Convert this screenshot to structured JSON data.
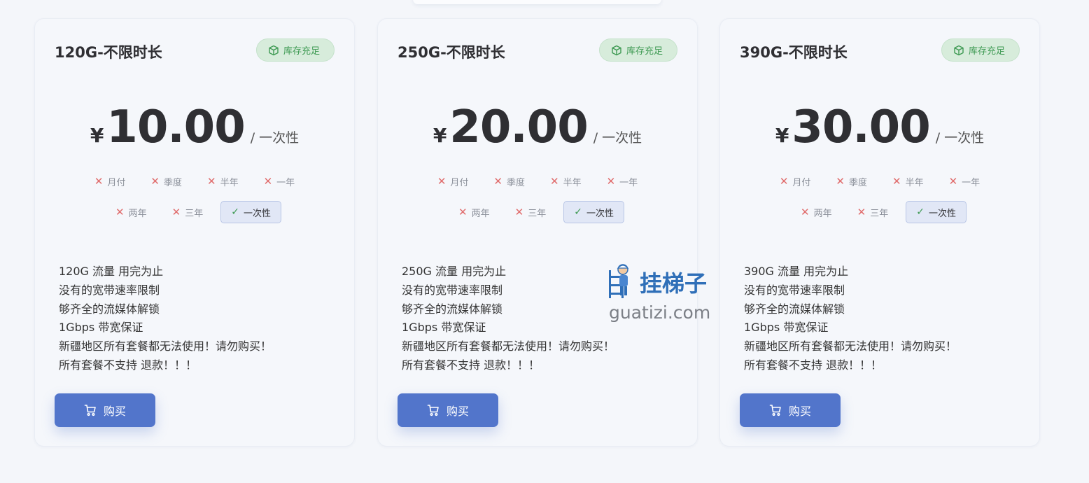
{
  "plans": [
    {
      "title": "120G-不限时长",
      "stock_label": "库存充足",
      "currency": "¥",
      "price": "10.00",
      "period": "/ 一次性",
      "cycles_row1": [
        "月付",
        "季度",
        "半年",
        "一年"
      ],
      "cycles_row2": [
        "两年",
        "三年"
      ],
      "selected_cycle": "一次性",
      "features": [
        "120G 流量 用完为止",
        "没有的宽带速率限制",
        "够齐全的流媒体解锁",
        "1Gbps 带宽保证",
        "新疆地区所有套餐都无法使用！请勿购买！",
        "所有套餐不支持 退款！！！"
      ],
      "buy_label": "购买"
    },
    {
      "title": "250G-不限时长",
      "stock_label": "库存充足",
      "currency": "¥",
      "price": "20.00",
      "period": "/ 一次性",
      "cycles_row1": [
        "月付",
        "季度",
        "半年",
        "一年"
      ],
      "cycles_row2": [
        "两年",
        "三年"
      ],
      "selected_cycle": "一次性",
      "features": [
        "250G 流量 用完为止",
        "没有的宽带速率限制",
        "够齐全的流媒体解锁",
        "1Gbps 带宽保证",
        "新疆地区所有套餐都无法使用！请勿购买！",
        "所有套餐不支持 退款！！！"
      ],
      "buy_label": "购买"
    },
    {
      "title": "390G-不限时长",
      "stock_label": "库存充足",
      "currency": "¥",
      "price": "30.00",
      "period": "/ 一次性",
      "cycles_row1": [
        "月付",
        "季度",
        "半年",
        "一年"
      ],
      "cycles_row2": [
        "两年",
        "三年"
      ],
      "selected_cycle": "一次性",
      "features": [
        "390G 流量 用完为止",
        "没有的宽带速率限制",
        "够齐全的流媒体解锁",
        "1Gbps 带宽保证",
        "新疆地区所有套餐都无法使用！请勿购买！",
        "所有套餐不支持 退款！！！"
      ],
      "buy_label": "购买"
    }
  ],
  "watermark": {
    "cn": "挂梯子",
    "en": "guatizi.com"
  },
  "colors": {
    "accent": "#5275cb",
    "stock_green": "#3e9a53",
    "unavailable_red": "#e06c6c",
    "page_bg": "#f4f6fa"
  }
}
